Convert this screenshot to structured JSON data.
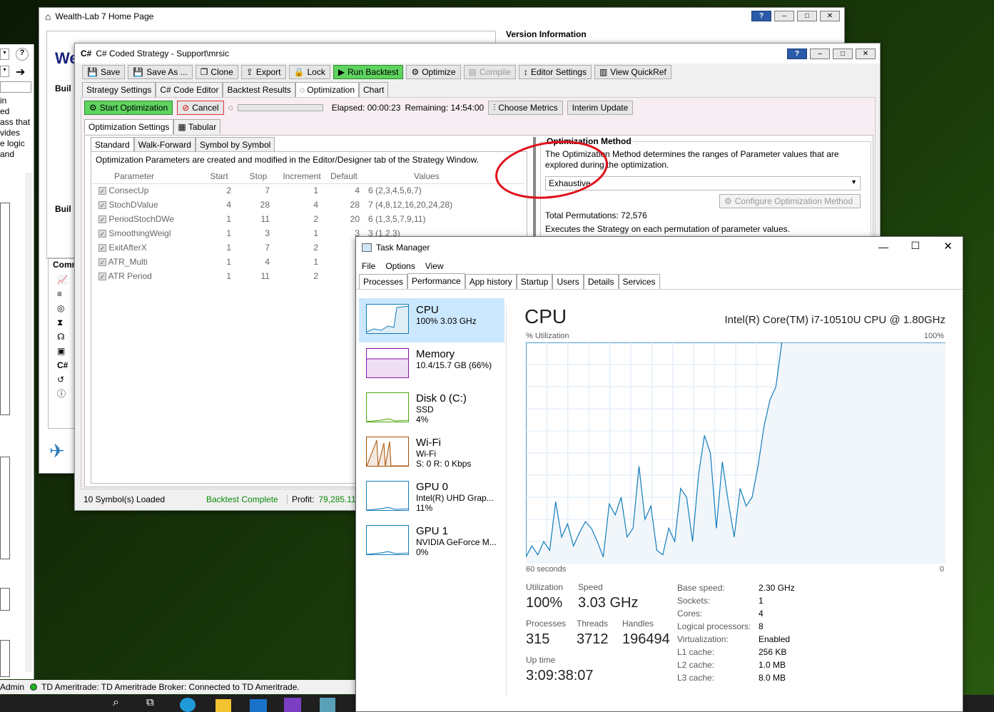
{
  "left_window": {
    "fragments": [
      "in",
      "ed",
      "ass that",
      "vides",
      "e logic",
      "and"
    ],
    "build1": "Buil",
    "build2": "Buil",
    "comm": "Comm",
    "we": "We"
  },
  "wl_home": {
    "title": "Wealth-Lab 7 Home Page",
    "version_header": "Version Information"
  },
  "strategy": {
    "title": "C# Coded Strategy - Support\\mrsic",
    "toolbar": [
      {
        "label": "Save",
        "icon": "save-icon"
      },
      {
        "label": "Save As ...",
        "icon": "save-icon"
      },
      {
        "label": "Clone",
        "icon": "clone-icon"
      },
      {
        "label": "Export",
        "icon": "export-icon"
      },
      {
        "label": "Lock",
        "icon": "lock-icon"
      },
      {
        "label": "Run Backtest",
        "icon": "play-icon"
      },
      {
        "label": "Optimize",
        "icon": "gear-icon"
      },
      {
        "label": "Compile",
        "icon": "compile-icon"
      },
      {
        "label": "Editor Settings",
        "icon": "editor-settings-icon"
      },
      {
        "label": "View QuickRef",
        "icon": "book-icon"
      }
    ],
    "tabs": [
      "Strategy Settings",
      "C# Code Editor",
      "Backtest Results",
      "Optimization",
      "Chart"
    ],
    "opt_bar": {
      "start": "Start Optimization",
      "cancel": "Cancel",
      "elapsed": "Elapsed: 00:00:23",
      "remaining": "Remaining: 14:54:00",
      "choose_metrics": "Choose Metrics",
      "interim": "Interim Update"
    },
    "subtabs": [
      "Optimization Settings",
      "Tabular"
    ],
    "modetabs": [
      "Standard",
      "Walk-Forward",
      "Symbol by Symbol"
    ],
    "info": "Optimization Parameters are created and modified in the Editor/Designer tab of the Strategy Window.",
    "columns": [
      "Parameter",
      "Start",
      "Stop",
      "Increment",
      "Default",
      "Values"
    ],
    "params": [
      {
        "name": "ConsecUp",
        "start": "2",
        "stop": "7",
        "inc": "1",
        "def": "4",
        "values": "6 (2,3,4,5,6,7)"
      },
      {
        "name": "StochDValue",
        "start": "4",
        "stop": "28",
        "inc": "4",
        "def": "28",
        "values": "7 (4,8,12,16,20,24,28)"
      },
      {
        "name": "PeriodStochDWe",
        "start": "1",
        "stop": "11",
        "inc": "2",
        "def": "20",
        "values": "6 (1,3,5,7,9,11)"
      },
      {
        "name": "SmoothingWeigl",
        "start": "1",
        "stop": "3",
        "inc": "1",
        "def": "3",
        "values": "3 (1,2,3)"
      },
      {
        "name": "ExitAfterX",
        "start": "1",
        "stop": "7",
        "inc": "2",
        "def": "5",
        "values": "4"
      },
      {
        "name": "ATR_Multi",
        "start": "1",
        "stop": "4",
        "inc": "1",
        "def": "3",
        "values": "4"
      },
      {
        "name": "ATR Period",
        "start": "1",
        "stop": "11",
        "inc": "2",
        "def": "7",
        "values": "6"
      }
    ],
    "method": {
      "title": "Optimization Method",
      "desc": "The Optimization Method determines the ranges of Parameter values that are explored during the optimization.",
      "selected": "Exhaustive",
      "configure": "Configure Optimization Method",
      "total": "Total Permutations: 72,576",
      "exec": "Executes the Strategy on each permutation of parameter values."
    },
    "status": {
      "symbols": "10 Symbol(s) Loaded",
      "backtest": "Backtest Complete",
      "profit_label": "Profit:",
      "profit": "79,285.11"
    }
  },
  "taskmgr": {
    "title": "Task Manager",
    "menu": [
      "File",
      "Options",
      "View"
    ],
    "tabs": [
      "Processes",
      "Performance",
      "App history",
      "Startup",
      "Users",
      "Details",
      "Services"
    ],
    "side": [
      {
        "name": "CPU",
        "l1": "100%  3.03 GHz",
        "l2": "",
        "color": "#117dbb"
      },
      {
        "name": "Memory",
        "l1": "10.4/15.7 GB (66%)",
        "l2": "",
        "color": "#8b12ae"
      },
      {
        "name": "Disk 0 (C:)",
        "l1": "SSD",
        "l2": "4%",
        "color": "#4da60c"
      },
      {
        "name": "Wi-Fi",
        "l1": "Wi-Fi",
        "l2": "S: 0  R: 0 Kbps",
        "color": "#a74f01"
      },
      {
        "name": "GPU 0",
        "l1": "Intel(R) UHD Grap...",
        "l2": "11%",
        "color": "#117dbb"
      },
      {
        "name": "GPU 1",
        "l1": "NVIDIA GeForce M...",
        "l2": "0%",
        "color": "#117dbb"
      }
    ],
    "cpu_title": "CPU",
    "cpu_model": "Intel(R) Core(TM) i7-10510U CPU @ 1.80GHz",
    "util_label": "% Utilization",
    "util_max": "100%",
    "x_left": "60 seconds",
    "x_right": "0",
    "stats": {
      "utilization_label": "Utilization",
      "utilization": "100%",
      "speed_label": "Speed",
      "speed": "3.03 GHz",
      "processes_label": "Processes",
      "processes": "315",
      "threads_label": "Threads",
      "threads": "3712",
      "handles_label": "Handles",
      "handles": "196494",
      "uptime_label": "Up time",
      "uptime": "3:09:38:07"
    },
    "specs": [
      [
        "Base speed:",
        "2.30 GHz"
      ],
      [
        "Sockets:",
        "1"
      ],
      [
        "Cores:",
        "4"
      ],
      [
        "Logical processors:",
        "8"
      ],
      [
        "Virtualization:",
        "Enabled"
      ],
      [
        "L1 cache:",
        "256 KB"
      ],
      [
        "L2 cache:",
        "1.0 MB"
      ],
      [
        "L3 cache:",
        "8.0 MB"
      ]
    ]
  },
  "cpu_series": [
    3,
    8,
    4,
    10,
    6,
    28,
    12,
    18,
    8,
    14,
    19,
    16,
    10,
    3,
    27,
    22,
    30,
    12,
    16,
    44,
    20,
    26,
    6,
    4,
    16,
    10,
    34,
    30,
    10,
    40,
    58,
    50,
    16,
    46,
    28,
    12,
    34,
    26,
    30,
    44,
    62,
    74,
    80,
    180
  ],
  "statusbar": {
    "admin": "Admin",
    "connection": "TD Ameritrade: TD Ameritrade Broker: Connected to TD Ameritrade."
  }
}
